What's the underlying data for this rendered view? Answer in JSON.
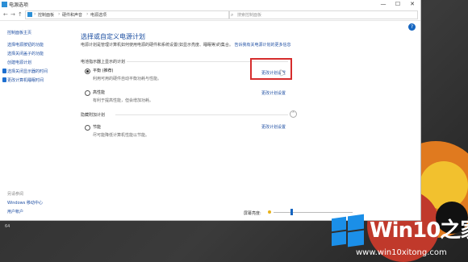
{
  "window": {
    "title": "电源选项",
    "controls": {
      "minimize": "—",
      "maximize": "☐",
      "close": "✕"
    }
  },
  "address": {
    "nav": {
      "back": "←",
      "forward": "→",
      "up": "↑"
    },
    "breadcrumbs": [
      "控制面板",
      "硬件和声音",
      "电源选项"
    ],
    "separator": "›",
    "refresh": "↻",
    "search_placeholder": "搜索控制面板"
  },
  "sidebar": {
    "home": "控制面板主页",
    "items": [
      "选择电源按钮的功能",
      "选择关闭盖子的功能",
      "创建电源计划",
      "选择关闭显示器的时间",
      "更改计算机睡眠时间"
    ],
    "see_also": "另请参阅",
    "bottom_items": [
      "Windows 移动中心",
      "用户帐户"
    ]
  },
  "main": {
    "heading": "选择或自定义电源计划",
    "description": "电源计划是管理计算机如何使用电源的硬件和系统设置(如显示亮度、睡眠等)的集合。",
    "description_link": "告诉我有关电源计划的更多信息",
    "help": "?",
    "group_title": "电池指示器上显示的计划",
    "plans": [
      {
        "name": "平衡 (推荐)",
        "desc": "利用可用的硬件自动平衡功耗与性能。",
        "link": "更改计划设置",
        "selected": true
      },
      {
        "name": "高性能",
        "desc": "有利于提高性能，但会增加功耗。",
        "link": "更改计划设置",
        "selected": false
      }
    ],
    "hidden_title": "隐藏附加计划",
    "hidden_toggle": "⌃",
    "hidden_plans": [
      {
        "name": "节能",
        "desc": "尽可能降低计算机性能以节能。",
        "link": "更改计划设置",
        "selected": false
      }
    ]
  },
  "bottom": {
    "brightness_label": "屏幕亮度:"
  },
  "watermark": {
    "brand": "Win10",
    "brand_cn": "之家",
    "url": "www.win10xitong.com"
  },
  "desktop": {
    "corner_tag": "64"
  },
  "colors": {
    "link": "#1f4fa3",
    "heading": "#1a4da0",
    "highlight": "#d62d2d",
    "logo_blue": "#1b8fe8"
  }
}
